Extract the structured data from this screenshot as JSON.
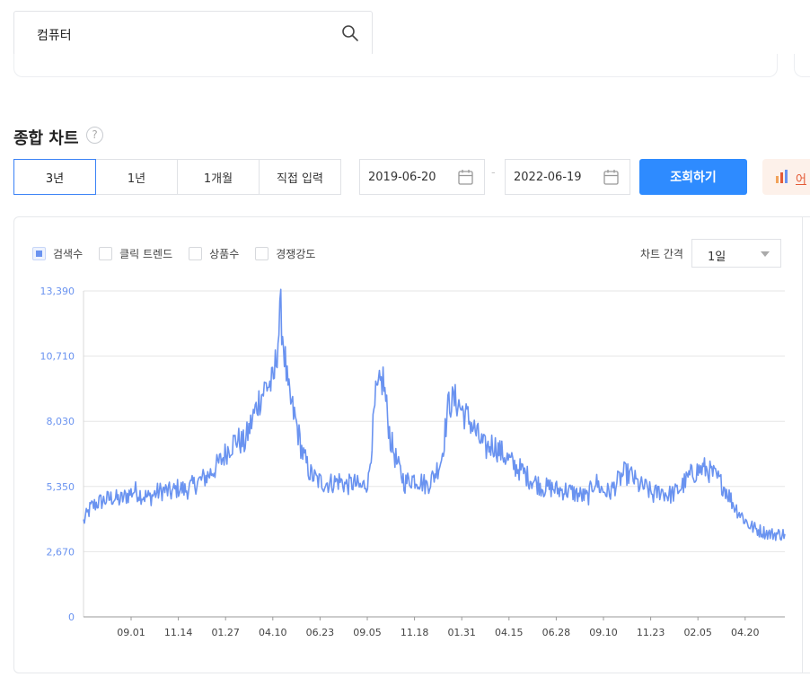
{
  "search": {
    "value": "컴퓨터"
  },
  "section": {
    "title": "종합 차트"
  },
  "period_tabs": [
    "3년",
    "1년",
    "1개월",
    "직접 입력"
  ],
  "date_range": {
    "start": "2019-06-20",
    "end": "2022-06-19"
  },
  "query_button": "조회하기",
  "ad_button": "어",
  "legend": [
    {
      "label": "검색수",
      "checked": true
    },
    {
      "label": "클릭 트렌드",
      "checked": false
    },
    {
      "label": "상품수",
      "checked": false
    },
    {
      "label": "경쟁강도",
      "checked": false
    }
  ],
  "interval": {
    "label": "차트 간격",
    "value": "1일"
  },
  "colors": {
    "series": "#6a93f0",
    "accent": "#2e8bff",
    "grid": "#e6e6e6",
    "ytick": "#6a93f0"
  },
  "chart_data": {
    "type": "line",
    "x_tick_labels": [
      "09.01",
      "11.14",
      "01.27",
      "04.10",
      "06.23",
      "09.05",
      "11.18",
      "01.31",
      "04.15",
      "06.28",
      "09.10",
      "11.23",
      "02.05",
      "04.20"
    ],
    "y_tick_labels": [
      "0",
      "2,670",
      "5,350",
      "8,030",
      "10,710",
      "13,390"
    ],
    "ylim": [
      0,
      13390
    ],
    "grid": true,
    "series": [
      {
        "values": [
          3900,
          4500,
          4700,
          4800,
          4900,
          4800,
          5000,
          5200,
          5000,
          4900,
          5100,
          5200,
          5100,
          5300,
          5200,
          5400,
          5600,
          5800,
          6100,
          6500,
          7000,
          7300,
          7100,
          8000,
          8900,
          9500,
          9600,
          12500,
          9200,
          8100,
          6700,
          5900,
          5600,
          5500,
          5500,
          5600,
          5400,
          5500,
          5300,
          5600,
          9000,
          9800,
          7300,
          6200,
          5500,
          5700,
          5600,
          5400,
          5800,
          6500,
          8800,
          8900,
          8400,
          8000,
          7400,
          6900,
          7100,
          6800,
          6500,
          6200,
          6000,
          5700,
          5500,
          5300,
          5300,
          5200,
          5200,
          5100,
          5000,
          4900,
          5600,
          5200,
          5100,
          5500,
          5900,
          5800,
          5400,
          5300,
          5000,
          5200,
          5000,
          5100,
          5400,
          5800,
          6000,
          6100,
          5900,
          5600,
          5200,
          4600,
          4200,
          3800,
          3600,
          3500,
          3400,
          3400,
          3400
        ]
      }
    ]
  }
}
